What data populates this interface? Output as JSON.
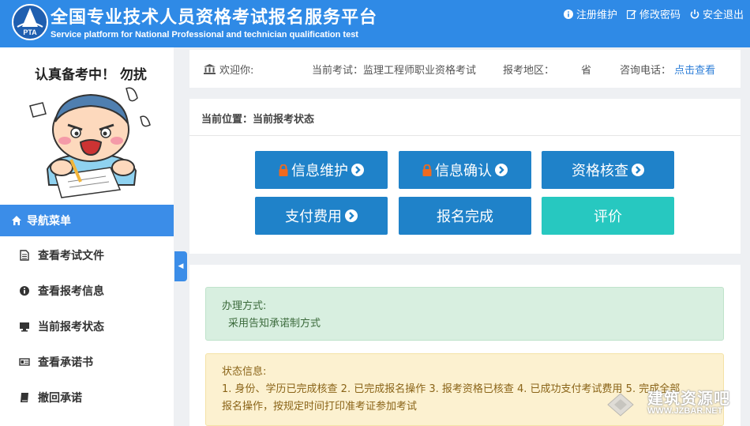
{
  "header": {
    "title_cn": "全国专业技术人员资格考试报名服务平台",
    "title_en": "Service platform for National Professional and technician qualification test",
    "logo_text": "PTA",
    "links": [
      {
        "label": "注册维护",
        "icon": "info-icon"
      },
      {
        "label": "修改密码",
        "icon": "edit-icon"
      },
      {
        "label": "安全退出",
        "icon": "power-icon"
      }
    ]
  },
  "sidebar": {
    "mascot_title": "认真备考中！ 勿扰",
    "nav_header": "导航菜单",
    "items": [
      {
        "label": "查看考试文件",
        "icon": "file-icon"
      },
      {
        "label": "查看报考信息",
        "icon": "info-icon"
      },
      {
        "label": "当前报考状态",
        "icon": "monitor-icon"
      },
      {
        "label": "查看承诺书",
        "icon": "card-icon"
      },
      {
        "label": "撤回承诺",
        "icon": "book-icon"
      }
    ]
  },
  "infobar": {
    "welcome": "欢迎你:",
    "current_exam": "当前考试：监理工程师职业资格考试",
    "region_label": "报考地区：",
    "province": "省",
    "phone_label": "咨询电话：",
    "phone_link": "点击查看"
  },
  "main": {
    "position": "当前位置：当前报考状态",
    "steps": [
      {
        "label": "信息维护",
        "lock": true,
        "arrow": true
      },
      {
        "label": "信息确认",
        "lock": true,
        "arrow": true
      },
      {
        "label": "资格核查",
        "lock": false,
        "arrow": true
      },
      {
        "label": "支付费用",
        "lock": false,
        "arrow": true
      },
      {
        "label": "报名完成",
        "lock": false,
        "arrow": false
      },
      {
        "label": "评价",
        "lock": false,
        "arrow": false
      }
    ]
  },
  "method": {
    "title": "办理方式:",
    "value": "采用告知承诺制方式"
  },
  "status": {
    "title": "状态信息:",
    "line1": "1. 身份、学历已完成核查 2. 已完成报名操作 3. 报考资格已核查 4. 已成功支付考试费用 5. 完成全部",
    "line2": "报名操作，按规定时间打印准考证参加考试"
  },
  "watermark": {
    "text": "建筑资源吧",
    "url": "WWW.JZBAR.NET"
  },
  "colors": {
    "header_bg": "#2f8ae6",
    "button_blue": "#1f82c9",
    "button_teal": "#27c8c0",
    "lock_orange": "#f06a1f"
  }
}
